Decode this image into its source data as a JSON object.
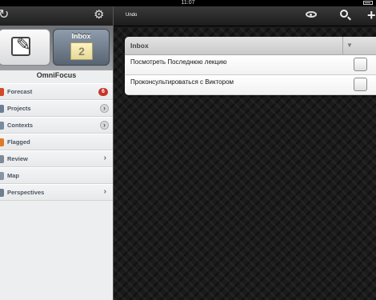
{
  "statusbar": {
    "time": "11:07"
  },
  "sidebar": {
    "inbox_tile": {
      "label": "Inbox",
      "count": "2"
    },
    "app_title": "OmniFocus",
    "items": [
      {
        "label": "Forecast",
        "badge": "6",
        "icon_color": "#d24a2a"
      },
      {
        "label": "Projects",
        "accessory": "disclosure-button",
        "icon_color": "#6b7f99"
      },
      {
        "label": "Contexts",
        "accessory": "disclosure-button",
        "icon_color": "#7a8aa0"
      },
      {
        "label": "Flagged",
        "icon_color": "#e07a26"
      },
      {
        "label": "Review",
        "accessory": "chevron",
        "icon_color": "#7e8a98"
      },
      {
        "label": "Map",
        "icon_color": "#8794a3"
      },
      {
        "label": "Perspectives",
        "accessory": "chevron",
        "icon_color": "#6f7d8e"
      }
    ]
  },
  "toolbar": {
    "undo_label": "Undo"
  },
  "inbox": {
    "title": "Inbox",
    "tasks": [
      {
        "text": "Посмотреть Последнюю лекцию"
      },
      {
        "text": "Проконсультироваться с Виктором"
      }
    ]
  }
}
